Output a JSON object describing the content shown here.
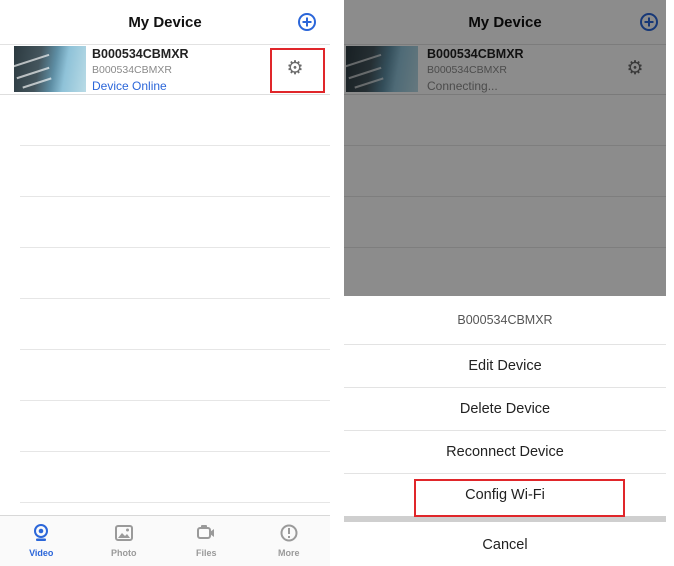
{
  "colors": {
    "accent": "#2b66d9",
    "highlight": "#e0262a",
    "connecting": "#8a8a8a"
  },
  "left_screen": {
    "title": "My Device",
    "add_icon": "plus-circle-icon",
    "device": {
      "name": "B000534CBMXR",
      "uid": "B000534CBMXR",
      "status": "Device Online"
    },
    "tabs": [
      {
        "label": "Video",
        "icon": "camera-icon",
        "active": true
      },
      {
        "label": "Photo",
        "icon": "image-icon",
        "active": false
      },
      {
        "label": "Files",
        "icon": "video-file-icon",
        "active": false
      },
      {
        "label": "More",
        "icon": "info-circle-icon",
        "active": false
      }
    ]
  },
  "right_screen": {
    "title": "My Device",
    "device": {
      "name": "B000534CBMXR",
      "uid": "B000534CBMXR",
      "status": "Connecting..."
    },
    "action_sheet": {
      "title": "B000534CBMXR",
      "items": [
        "Edit Device",
        "Delete Device",
        "Reconnect Device",
        "Config Wi-Fi"
      ],
      "cancel": "Cancel"
    }
  }
}
